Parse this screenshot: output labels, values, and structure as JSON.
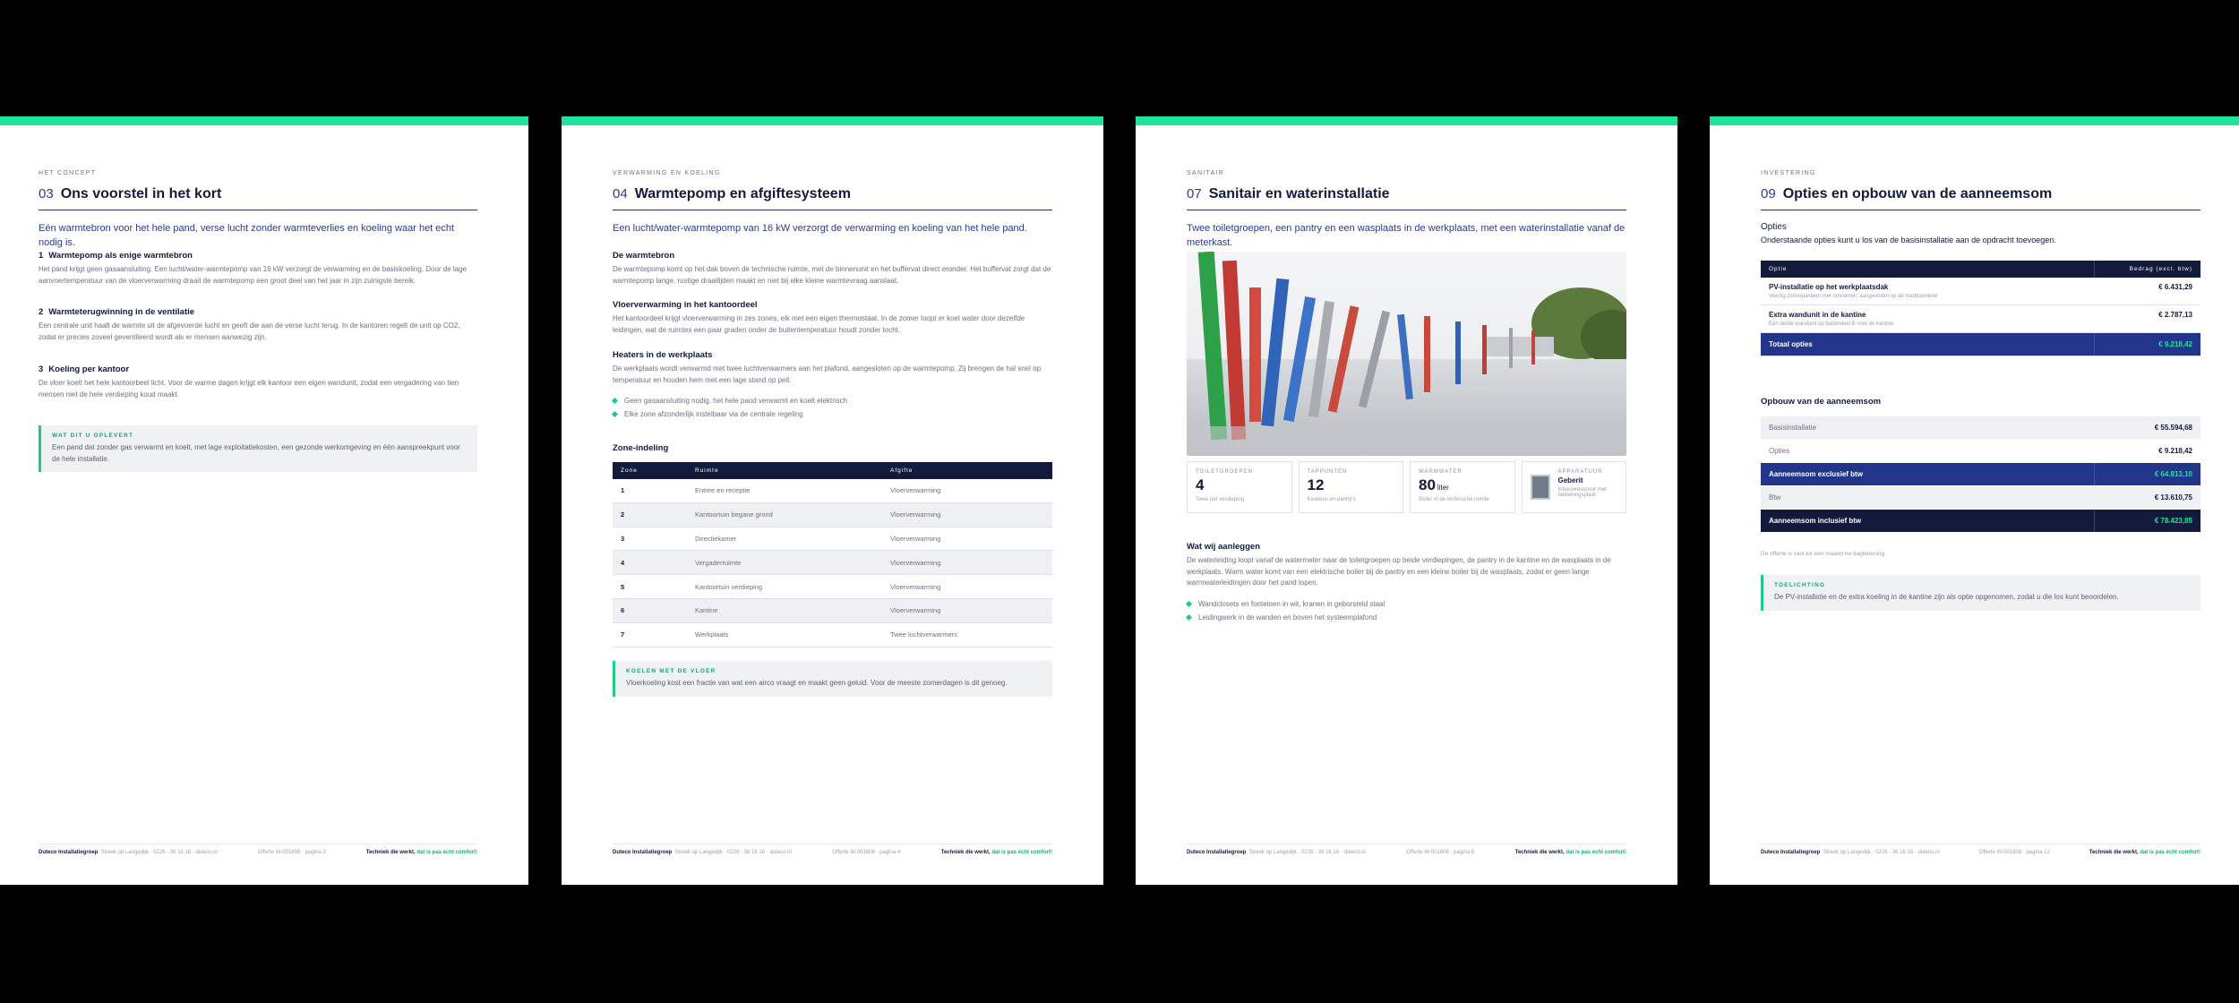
{
  "footer": {
    "company": "Duteco Installatiegroep",
    "contact": "Streek op Langedijk · 0226 - 36 16 16 · duteco.nl",
    "tagline_a": "Techniek die werkt,",
    "tagline_b": "dat is pas écht comfort!"
  },
  "page1": {
    "eyebrow": "Het concept",
    "num": "03",
    "title": "Ons voorstel in het kort",
    "lead": "Eén warmtebron voor het hele pand, verse lucht zonder warmteverlies en koeling waar het echt nodig is.",
    "items": [
      {
        "n": "1",
        "h": "Warmtepomp als enige warmtebron",
        "p": "Het pand krijgt geen gasaansluiting. Een lucht/water-warmtepomp van 16 kW verzorgt de verwarming en de basiskoeling. Door de lage aanvoertemperatuur van de vloerverwarming draait de warmtepomp een groot deel van het jaar in zijn zuinigste bereik."
      },
      {
        "n": "2",
        "h": "Warmteterugwinning in de ventilatie",
        "p": "Een centrale unit haalt de warmte uit de afgevoerde lucht en geeft die aan de verse lucht terug. In de kantoren regelt de unit op CO2, zodat er precies zoveel geventileerd wordt als er mensen aanwezig zijn."
      },
      {
        "n": "3",
        "h": "Koeling per kantoor",
        "p": "De vloer koelt het hele kantoorbeel licht. Voor de warme dagen krijgt elk kantoor een eigen wandunit, zodat een vergadering van tien mensen niet de hele verdieping koud maakt."
      }
    ],
    "callout_label": "Wat dit u oplevert",
    "callout_text": "Een pand dat zonder gas verwarmt en koelt, met lage exploitatiekosten, een gezonde werkomgeving en één aanspreekpunt voor de hele installatie.",
    "footer_ref": "Offerte W-001808 · pagina 3"
  },
  "page2": {
    "eyebrow": "Verwarming en koeling",
    "num": "04",
    "title": "Warmtepomp en afgiftesysteem",
    "lead": "Een lucht/water-warmtepomp van 16 kW verzorgt de verwarming en koeling van het hele pand.",
    "s1_h": "De warmtebron",
    "s1_p": "De warmtepomp komt op het dak boven de technische ruimte, met de binnenunit en het buffervat direct eronder. Het buffervat zorgt dat de warmtepomp lange, rustige draaitijden maakt en niet bij elke kleine warmtevraag aanslaat.",
    "s2_h": "Vloerverwarming in het kantoordeel",
    "s2_p": "Het kantoordeel krijgt vloerverwarming in zes zones, elk met een eigen thermostaat. In de zomer loopt er koel water door dezelfde leidingen, wat de ruimtes een paar graden onder de buitentemperatuur houdt zonder tocht.",
    "s3_h": "Heaters in de werkplaats",
    "s3_p": "De werkplaats wordt verwarmd met twee luchtverwarmers aan het plafond, aangesloten op de warmtepomp. Zij brengen de hal snel op temperatuur en houden hem met een lage stand op peil.",
    "bullets": [
      "Geen gasaansluiting nodig, het hele pand verwarmt en koelt elektrisch",
      "Elke zone afzonderlijk instelbaar via de centrale regeling"
    ],
    "zone_title": "Zone-indeling",
    "zone_headers": [
      "Zone",
      "Ruimte",
      "Afgifte"
    ],
    "zones": [
      [
        "1",
        "Entree en receptie",
        "Vloerverwarming"
      ],
      [
        "2",
        "Kantoortuin begane grond",
        "Vloerverwarming"
      ],
      [
        "3",
        "Directiekamer",
        "Vloerverwarming"
      ],
      [
        "4",
        "Vergaderruimte",
        "Vloerverwarming"
      ],
      [
        "5",
        "Kantoortuin verdieping",
        "Vloerverwarming"
      ],
      [
        "6",
        "Kantine",
        "Vloerverwarming"
      ],
      [
        "7",
        "Werkplaats",
        "Twee luchtverwarmers"
      ]
    ],
    "callout_label": "Koelen met de vloer",
    "callout_text": "Vloerkoeling kost een fractie van wat een airco vraagt en maakt geen geluid. Voor de meeste zomerdagen is dit genoeg.",
    "footer_ref": "Offerte W-001808 · pagina 4"
  },
  "page3": {
    "eyebrow": "Sanitair",
    "num": "07",
    "title": "Sanitair en waterinstallatie",
    "lead": "Twee toiletgroepen, een pantry en een wasplaats in de werkplaats, met een waterinstallatie vanaf de meterkast.",
    "stats": [
      {
        "label": "Toiletgroepen",
        "value": "4",
        "unit": "",
        "sub": "Twee per verdieping"
      },
      {
        "label": "Tappunten",
        "value": "12",
        "unit": "",
        "sub": "Keukens en pantry's"
      },
      {
        "label": "Warmwater",
        "value": "80",
        "unit": "liter",
        "sub": "Boiler in de technische ruimte"
      }
    ],
    "product": {
      "label": "Apparatuur",
      "name": "Geberit",
      "sub": "Inbouwreservoir met bedieningsplaat"
    },
    "s_h": "Wat wij aanleggen",
    "s_p": "De waterleiding loopt vanaf de watermeter naar de toiletgroepen op beide verdiepingen, de pantry in de kantine en de wasplaats in de werkplaats. Warm water komt van een elektrische boiler bij de pantry en een kleine boiler bij de wasplaats, zodat er geen lange warmwaterleidingen door het pand lopen.",
    "bullets": [
      "Wandclosets en fonteinen in wit, kranen in geborsteld staal",
      "Leidingwerk in de wanden en boven het systeemplafond"
    ],
    "footer_ref": "Offerte W-001808 · pagina 6"
  },
  "page4": {
    "eyebrow": "Investering",
    "num": "09",
    "title": "Opties en opbouw van de aanneemsom",
    "opt_h": "Opties",
    "opt_p": "Onderstaande opties kunt u los van de basisinstallatie aan de opdracht toevoegen.",
    "opt_headers": [
      "Optie",
      "Bedrag (excl. btw)"
    ],
    "options": [
      {
        "name": "PV-installatie op het werkplaatsdak",
        "desc": "Veertig zonnepanelen met omvormer, aangesloten op de hoofdverdeler",
        "amount": "€ 6.431,29"
      },
      {
        "name": "Extra wandunit in de kantine",
        "desc": "Een derde wandunit op buitendeel B voor de kantine",
        "amount": "€ 2.787,13"
      }
    ],
    "opt_total_label": "Totaal opties",
    "opt_total": "€ 9.218,42",
    "sum_h": "Opbouw van de aanneemsom",
    "sum_rows": [
      {
        "label": "Basisinstallatie",
        "amount": "€ 55.594,68",
        "style": "g"
      },
      {
        "label": "Opties",
        "amount": "€ 9.218,42",
        "style": ""
      },
      {
        "label": "Aanneemsom exclusief btw",
        "amount": "€ 64.813,10",
        "style": "bl"
      },
      {
        "label": "Btw",
        "amount": "€ 13.610,75",
        "style": "g"
      },
      {
        "label": "Aanneemsom inclusief btw",
        "amount": "€ 78.423,85",
        "style": "dk"
      }
    ],
    "note": "De offerte is vast tot een maand na dagtekening.",
    "callout_label": "Toelichting",
    "callout_text": "De PV-installatie en de extra koeling in de kantine zijn als optie opgenomen, zodat u die los kunt beoordelen.",
    "footer_ref": "Offerte W-001808 · pagina 12"
  }
}
